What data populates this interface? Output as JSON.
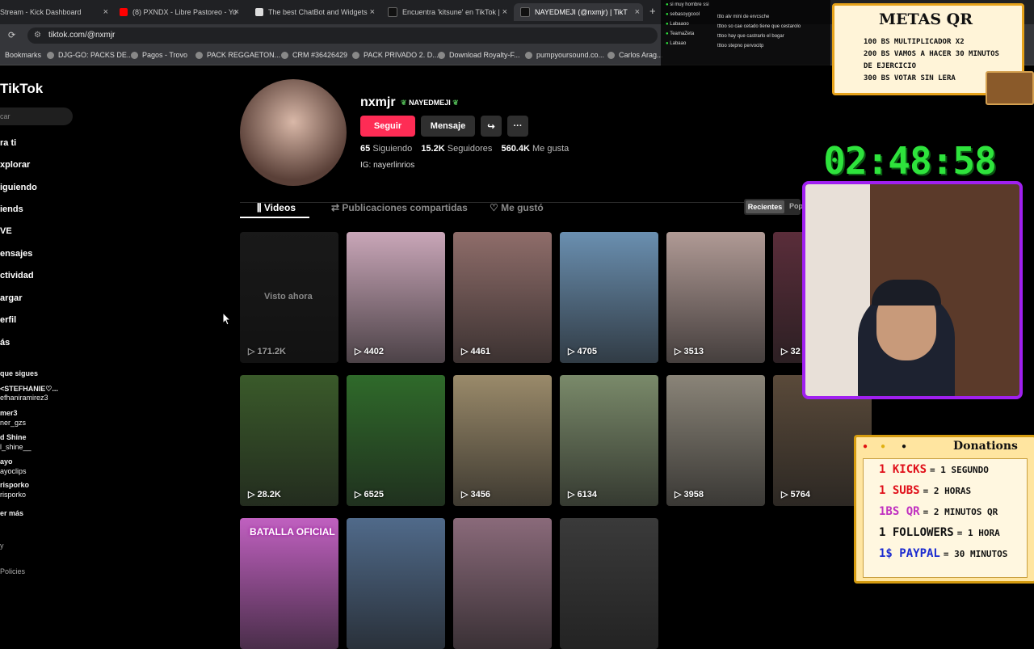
{
  "browser": {
    "tabs": [
      {
        "label": "Stream - Kick Dashboard",
        "color": "#2ee33c"
      },
      {
        "label": "(8) PXNDX - Libre Pastoreo - Yo",
        "color": "#ff0000"
      },
      {
        "label": "The best ChatBot and Widgets",
        "color": "#ffffff"
      },
      {
        "label": "Encuentra 'kitsune' en TikTok |",
        "color": "#ffffff"
      },
      {
        "label": "NAYEDMEJI (@nxmjr) | TikT",
        "color": "#ffffff"
      }
    ],
    "url": "tiktok.com/@nxmjr",
    "bookmarks": [
      "Bookmarks",
      "DJG-GO: PACKS DE...",
      "Pagos - Trovo",
      "PACK REGGAETON...",
      "CRM #36426429",
      "PACK PRIVADO 2. D...",
      "Download Royalty-F...",
      "pumpyoursound.co...",
      "Carlos Arag..."
    ]
  },
  "sidebar": {
    "logo": "TikTok",
    "search_placeholder": "car",
    "items": [
      "ra ti",
      "xplorar",
      "iguiendo",
      "iends",
      "VE",
      "ensajes",
      "ctividad",
      "argar",
      "erfil",
      "ás"
    ],
    "following_title": "que sigues",
    "following": [
      {
        "name": "<STEFHANIE♡...",
        "handle": "efhaniramirez3"
      },
      {
        "name": "mer3",
        "handle": "ner_gzs"
      },
      {
        "name": "d Shine",
        "handle": "l_shine__"
      },
      {
        "name": "ayo",
        "handle": "ayoclips"
      },
      {
        "name": "risporko",
        "handle": "risporko"
      }
    ],
    "see_more": "er más",
    "footer1": "y",
    "footer2": "Policies"
  },
  "profile": {
    "username": "nxmjr",
    "display_name": "NAYEDMEJI",
    "follow_label": "Seguir",
    "message_label": "Mensaje",
    "following_count": "65",
    "following_label": "Siguiendo",
    "followers_count": "15.2K",
    "followers_label": "Seguidores",
    "likes_count": "560.4K",
    "likes_label": "Me gusta",
    "bio": "IG: nayerlinrios",
    "tabs": [
      "Videos",
      "Publicaciones compartidas",
      "Me gustó"
    ],
    "sort_recent": "Recientes",
    "sort_popular": "Pop",
    "watched_label": "Visto ahora",
    "brand_color": "#fe2c55"
  },
  "videos": [
    {
      "views": "171.2K",
      "color": "#2a2a2a"
    },
    {
      "views": "4402",
      "color": "#c9a6b8"
    },
    {
      "views": "4461",
      "color": "#8f6d6a"
    },
    {
      "views": "4705",
      "color": "#6a8fb0"
    },
    {
      "views": "3513",
      "color": "#b09a95"
    },
    {
      "views": "32",
      "color": "#5a2d3a"
    },
    {
      "views": "28.2K",
      "color": "#3a5a2a"
    },
    {
      "views": "6525",
      "color": "#2f6a2a"
    },
    {
      "views": "3456",
      "color": "#9a8a6a"
    },
    {
      "views": "6134",
      "color": "#7a8a6a"
    },
    {
      "views": "3958",
      "color": "#8a8478"
    },
    {
      "views": "5764",
      "color": "#5a4a3a"
    },
    {
      "views": "",
      "color": "#c060c0",
      "label": "BATALLA OFICIAL"
    },
    {
      "views": "",
      "color": "#506a8a"
    },
    {
      "views": "",
      "color": "#8a6a7a"
    },
    {
      "views": "",
      "color": "#3a3a3a"
    }
  ],
  "overlay": {
    "metas_title": "METAS QR",
    "metas": [
      "100 BS MULTIPLICADOR X2",
      "200 BS VAMOS A HACER 30 MINUTOS",
      "DE EJERCICIO",
      "300 BS VOTAR SIN LERA"
    ],
    "timer": "02:48:58",
    "donations_title": "Donations",
    "donations": [
      {
        "label": "1 KICKS",
        "value": "= 1 SEGUNDO",
        "color": "#e0101a"
      },
      {
        "label": "1 SUBS",
        "value": "= 2 HORAS",
        "color": "#e0101a"
      },
      {
        "label": "1BS QR",
        "value": "= 2 MINUTOS QR",
        "color": "#c030c0"
      },
      {
        "label": "1 FOLLOWERS",
        "value": "= 1 HORA",
        "color": "#111111"
      },
      {
        "label": "1$ PAYPAL",
        "value": "= 30 MINUTOS",
        "color": "#1a2ad0"
      }
    ],
    "chat": [
      "si muy hombre ssi",
      "sebasoygcool",
      "ttto alv mini de ervcsche",
      "Labaaoo",
      "tttoo so cae cetado tiene que cestarolo",
      "TeamaZeta",
      "tttoo hay que castrarlo el bogar",
      "Labaao",
      "tttoo stepno pervocitp"
    ]
  }
}
